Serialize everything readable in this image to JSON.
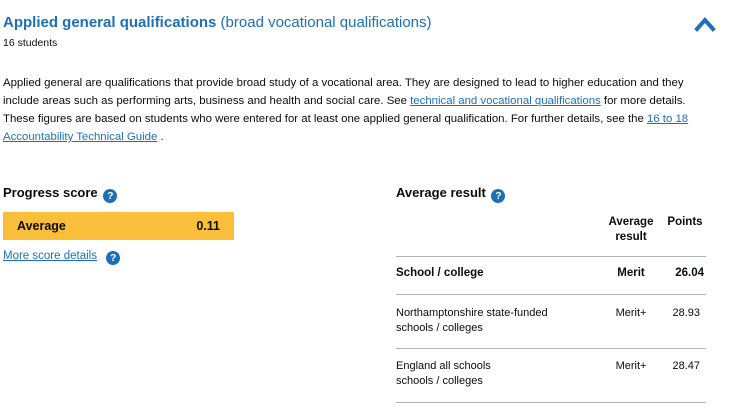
{
  "header": {
    "title_bold": "Applied general qualifications",
    "title_light": "(broad vocational qualifications)",
    "students": "16 students",
    "collapse_icon": "chevron-up-icon"
  },
  "description": {
    "text1": "Applied general are qualifications that provide broad study of a vocational area. They are designed to lead to higher education and they include areas such as performing arts, business and health and social care. See ",
    "link1": "technical and vocational qualifications",
    "text2": " for more details. These figures are based on students who were entered for at least one applied general qualification. For further details, see the ",
    "link2": "16 to 18 Accountability Technical Guide",
    "text3": " ."
  },
  "progress": {
    "heading": "Progress score",
    "band": "Average",
    "score": "0.11",
    "more_link": "More score details",
    "band_color": "#f9be3a"
  },
  "average_result": {
    "heading": "Average result",
    "columns": {
      "result_line1": "Average",
      "result_line2": "result",
      "points": "Points"
    },
    "rows": [
      {
        "name_line1": "School / college",
        "name_line2": "",
        "result": "Merit",
        "points": "26.04"
      },
      {
        "name_line1": "Northamptonshire state-funded",
        "name_line2": "schools / colleges",
        "result": "Merit+",
        "points": "28.93"
      },
      {
        "name_line1": "England all schools",
        "name_line2": "schools / colleges",
        "result": "Merit+",
        "points": "28.47"
      }
    ]
  },
  "help_icon_glyph": "?",
  "accent_color": "#1d70b8"
}
